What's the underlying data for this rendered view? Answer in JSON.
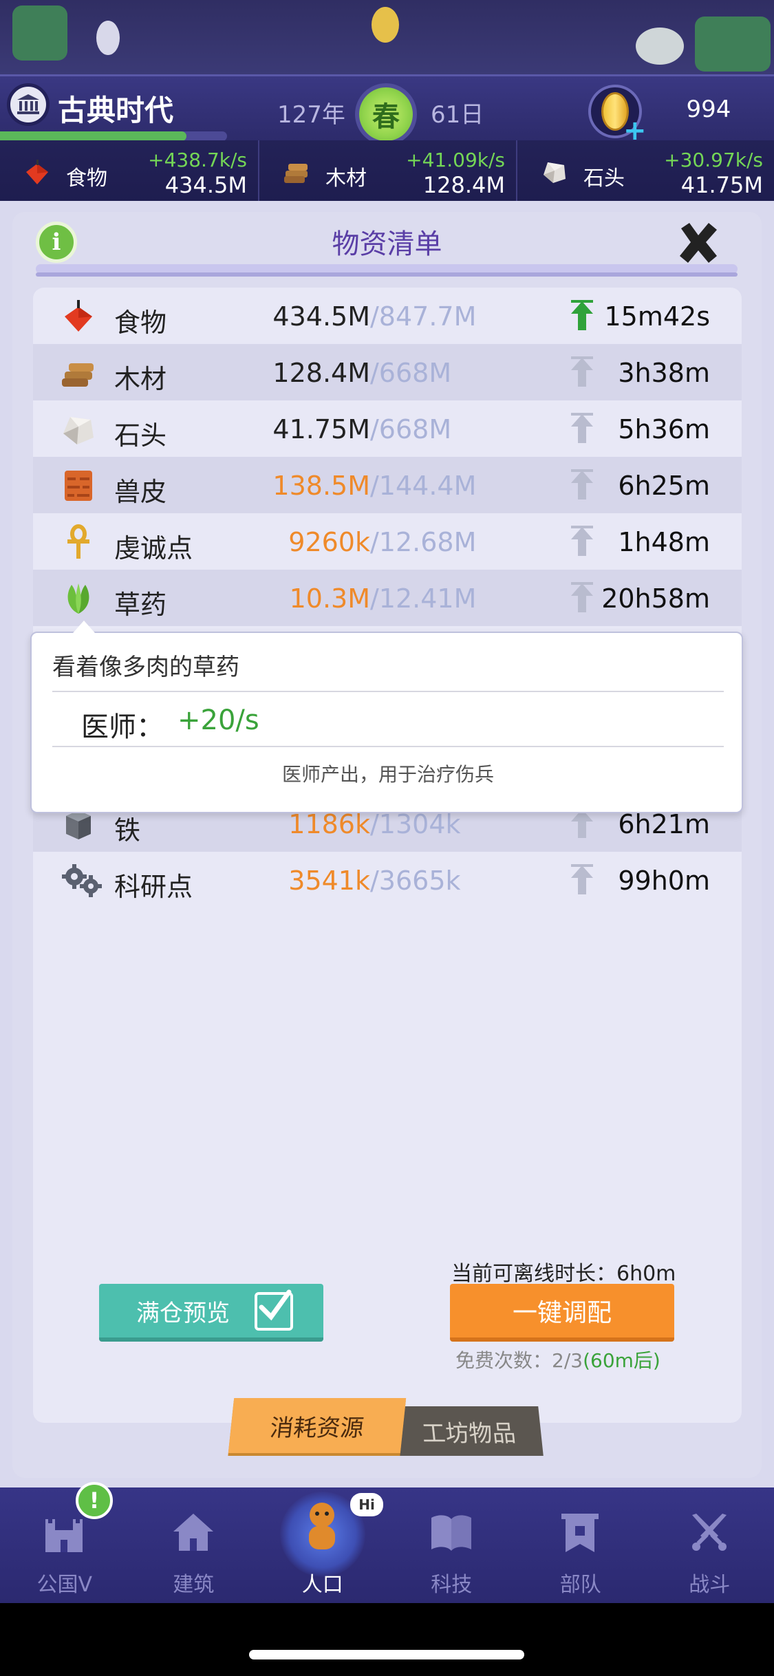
{
  "header": {
    "era": "古典时代",
    "era_progress": 0.82,
    "year": "127年",
    "season": "春",
    "day": "61日",
    "gold": "994"
  },
  "top_resources": [
    {
      "name": "食物",
      "rate": "+438.7k/s",
      "amount": "434.5M",
      "icon": "food-icon"
    },
    {
      "name": "木材",
      "rate": "+41.09k/s",
      "amount": "128.4M",
      "icon": "wood-icon"
    },
    {
      "name": "石头",
      "rate": "+30.97k/s",
      "amount": "41.75M",
      "icon": "stone-icon"
    }
  ],
  "panel": {
    "title": "物资清单",
    "rows": [
      {
        "name": "食物",
        "current": "434.5M",
        "cap": "/847.7M",
        "time": "15m42s",
        "orange": false,
        "arrow_active": true,
        "icon": "food-icon"
      },
      {
        "name": "木材",
        "current": "128.4M",
        "cap": "/668M",
        "time": "3h38m",
        "orange": false,
        "arrow_active": false,
        "icon": "wood-icon"
      },
      {
        "name": "石头",
        "current": "41.75M",
        "cap": "/668M",
        "time": "5h36m",
        "orange": false,
        "arrow_active": false,
        "icon": "stone-icon"
      },
      {
        "name": "兽皮",
        "current": "138.5M",
        "cap": "/144.4M",
        "time": "6h25m",
        "orange": true,
        "arrow_active": false,
        "icon": "hide-icon"
      },
      {
        "name": "虔诚点",
        "current": "9260k",
        "cap": "/12.68M",
        "time": "1h48m",
        "orange": true,
        "arrow_active": false,
        "icon": "ankh-icon"
      },
      {
        "name": "草药",
        "current": "10.3M",
        "cap": "/12.41M",
        "time": "20h58m",
        "orange": true,
        "arrow_active": false,
        "icon": "herb-icon"
      },
      {
        "name": "铁",
        "current": "1186k",
        "cap": "/1304k",
        "time": "6h21m",
        "orange": true,
        "arrow_active": false,
        "icon": "iron-icon"
      },
      {
        "name": "科研点",
        "current": "3541k",
        "cap": "/3665k",
        "time": "99h0m",
        "orange": true,
        "arrow_active": false,
        "icon": "gears-icon"
      }
    ],
    "tooltip": {
      "title": "看着像多肉的草药",
      "label": "医师：",
      "value": "+20/s",
      "desc": "医师产出，用于治疗伤兵"
    },
    "offline": "当前可离线时长：6h0m",
    "full_preview": "满仓预览",
    "allocate": "一键调配",
    "free_count": "免费次数：2/3",
    "free_timer": "(60m后)",
    "tab_consume": "消耗资源",
    "tab_workshop": "工坊物品"
  },
  "nav": [
    {
      "label": "公国Ⅴ",
      "icon": "castle-icon",
      "active": false
    },
    {
      "label": "建筑",
      "icon": "house-icon",
      "active": false
    },
    {
      "label": "人口",
      "icon": "person-icon",
      "active": true
    },
    {
      "label": "科技",
      "icon": "book-icon",
      "active": false
    },
    {
      "label": "部队",
      "icon": "banner-icon",
      "active": false
    },
    {
      "label": "战斗",
      "icon": "swords-icon",
      "active": false
    }
  ],
  "colors": {
    "accent_green": "#74d656",
    "orange": "#ef8a2a",
    "title_purple": "#5a3ea6",
    "allocate_button": "#f7902c",
    "preview_button": "#4dbfae"
  }
}
